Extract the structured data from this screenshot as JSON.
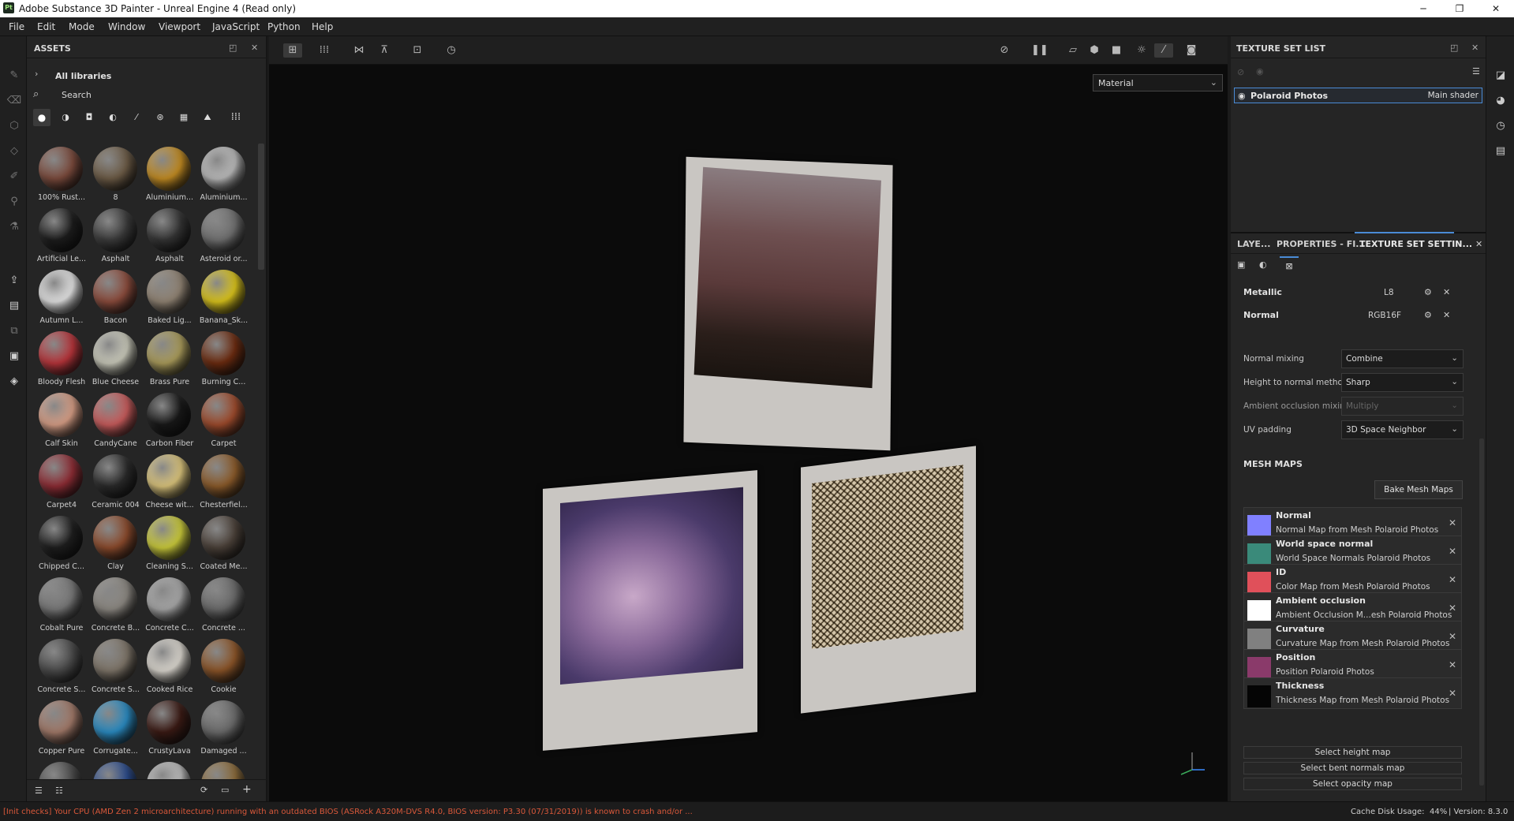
{
  "window": {
    "logo": "Pt",
    "title": "Adobe Substance 3D Painter - Unreal Engine 4 (Read only)",
    "minimize": "─",
    "maximize": "❐",
    "close": "✕"
  },
  "menu": [
    "File",
    "Edit",
    "Mode",
    "Window",
    "Viewport",
    "JavaScript",
    "Python",
    "Help"
  ],
  "assets": {
    "title": "ASSETS",
    "breadcrumb": "All libraries",
    "search_placeholder": "Search",
    "items": [
      {
        "label": "100% Rust...",
        "color": "#7a4a3c"
      },
      {
        "label": "8",
        "color": "#6b5a45"
      },
      {
        "label": "Aluminium...",
        "color": "#c08a22"
      },
      {
        "label": "Aluminium...",
        "color": "#b8b8b8"
      },
      {
        "label": "Artificial Le...",
        "color": "#1c1c1c"
      },
      {
        "label": "Asphalt",
        "color": "#3a3a3a"
      },
      {
        "label": "Asphalt",
        "color": "#333333"
      },
      {
        "label": "Asteroid or...",
        "color": "#6f6f6f"
      },
      {
        "label": "Autumn L...",
        "color": "#e0e0e0"
      },
      {
        "label": "Bacon",
        "color": "#8a4b3c"
      },
      {
        "label": "Baked Lig...",
        "color": "#8f8272"
      },
      {
        "label": "Banana_Sk...",
        "color": "#d8c21c"
      },
      {
        "label": "Bloody Flesh",
        "color": "#b5343a"
      },
      {
        "label": "Blue Cheese",
        "color": "#c7c7b8"
      },
      {
        "label": "Brass Pure",
        "color": "#a89a5a"
      },
      {
        "label": "Burning C...",
        "color": "#6b2b10"
      },
      {
        "label": "Calf Skin",
        "color": "#d49c84"
      },
      {
        "label": "CandyCane",
        "color": "#c65b5b"
      },
      {
        "label": "Carbon Fiber",
        "color": "#181818"
      },
      {
        "label": "Carpet",
        "color": "#9c4a2c"
      },
      {
        "label": "Carpet4",
        "color": "#8c2c34"
      },
      {
        "label": "Ceramic 004",
        "color": "#2a2a2a"
      },
      {
        "label": "Cheese wit...",
        "color": "#d8c27a"
      },
      {
        "label": "Chesterfiel...",
        "color": "#8a5a2a"
      },
      {
        "label": "Chipped C...",
        "color": "#1e1e1e"
      },
      {
        "label": "Clay",
        "color": "#8a4a2c"
      },
      {
        "label": "Cleaning S...",
        "color": "#c8c83a"
      },
      {
        "label": "Coated Me...",
        "color": "#4a4038"
      },
      {
        "label": "Cobalt Pure",
        "color": "#777777"
      },
      {
        "label": "Concrete B...",
        "color": "#8a8680"
      },
      {
        "label": "Concrete C...",
        "color": "#a5a5a5"
      },
      {
        "label": "Concrete ...",
        "color": "#6a6a6a"
      },
      {
        "label": "Concrete S...",
        "color": "#4a4a4a"
      },
      {
        "label": "Concrete S...",
        "color": "#7d7468"
      },
      {
        "label": "Cooked Rice",
        "color": "#d8d4cc"
      },
      {
        "label": "Cookie",
        "color": "#8a5428"
      },
      {
        "label": "Copper Pure",
        "color": "#a07868"
      },
      {
        "label": "Corrugate...",
        "color": "#2a8ac0"
      },
      {
        "label": "CrustyLava",
        "color": "#3a1a14"
      },
      {
        "label": "Damaged ...",
        "color": "#6a6a6a"
      },
      {
        "label": "",
        "color": "#4a4a4a"
      },
      {
        "label": "",
        "color": "#2a4a8a"
      },
      {
        "label": "",
        "color": "#bbbbbb"
      },
      {
        "label": "",
        "color": "#8a6a3a"
      }
    ]
  },
  "viewport": {
    "material_mode": "Material"
  },
  "texture_set_list": {
    "title": "TEXTURE SET LIST",
    "item_name": "Polaroid Photos",
    "item_shader": "Main shader"
  },
  "tabs": [
    "LAYE...",
    "PROPERTIES - FI...",
    "TEXTURE SET SETTIN..."
  ],
  "channels": [
    {
      "name": "Metallic",
      "format": "L8"
    },
    {
      "name": "Normal",
      "format": "RGB16F"
    }
  ],
  "settings": [
    {
      "label": "Normal mixing",
      "value": "Combine"
    },
    {
      "label": "Height to normal method",
      "value": "Sharp"
    },
    {
      "label": "Ambient occlusion mixing",
      "value": "Multiply"
    },
    {
      "label": "UV padding",
      "value": "3D Space Neighbor"
    }
  ],
  "mesh_maps": {
    "title": "MESH MAPS",
    "bake_button": "Bake Mesh Maps",
    "items": [
      {
        "name": "Normal",
        "desc": "Normal Map from Mesh Polaroid Photos",
        "color": "#8080ff"
      },
      {
        "name": "World space normal",
        "desc": "World Space Normals Polaroid Photos",
        "color": "#3a8a7a"
      },
      {
        "name": "ID",
        "desc": "Color Map from Mesh Polaroid Photos",
        "color": "#e0505a"
      },
      {
        "name": "Ambient occlusion",
        "desc": "Ambient Occlusion M...esh Polaroid Photos",
        "color": "#ffffff"
      },
      {
        "name": "Curvature",
        "desc": "Curvature Map from Mesh Polaroid Photos",
        "color": "#808080"
      },
      {
        "name": "Position",
        "desc": "Position Polaroid Photos",
        "color": "#8a3a6a"
      },
      {
        "name": "Thickness",
        "desc": "Thickness Map from Mesh Polaroid Photos",
        "color": "#050505"
      }
    ],
    "select_buttons": [
      "Select height map",
      "Select bent normals map",
      "Select opacity map"
    ]
  },
  "status": {
    "message": "[Init checks] Your CPU (AMD Zen 2 microarchitecture) running with an outdated BIOS (ASRock A320M-DVS R4.0, BIOS version: P3.30 (07/31/2019)) is known to crash and/or ...",
    "cache": "Cache Disk Usage:",
    "cache_pct": "44%",
    "version": "| Version: 8.3.0"
  },
  "colors": {
    "accent": "#4a8bd6",
    "status_error": "#d9583a"
  }
}
